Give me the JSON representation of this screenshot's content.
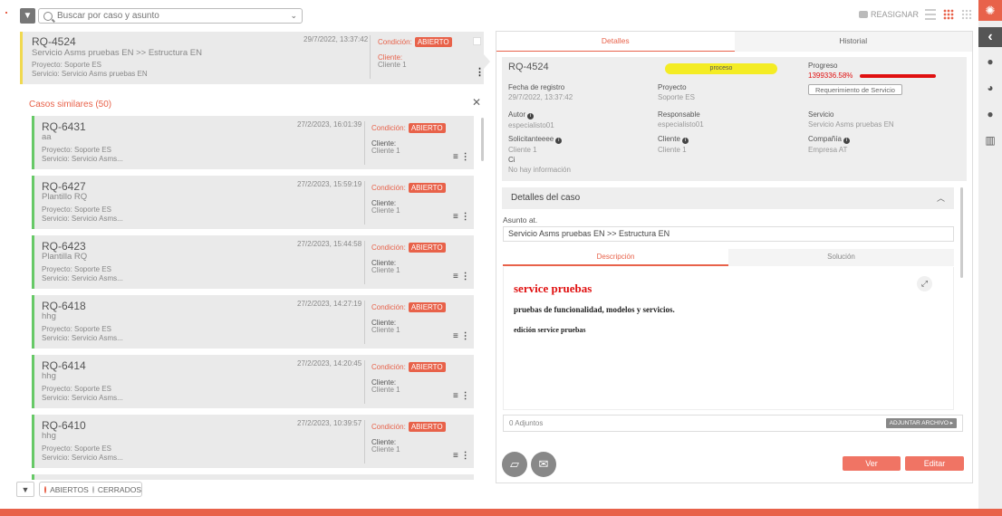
{
  "search": {
    "placeholder": "Buscar por caso y asunto"
  },
  "toolbar": {
    "reasignar": "REASIGNAR"
  },
  "selected": {
    "id": "RQ-4524",
    "subject": "Servicio Asms pruebas EN >> Estructura EN",
    "project": "Proyecto: Soporte ES",
    "service": "Servicio: Servicio Asms pruebas EN",
    "date": "29/7/2022, 13:37:42",
    "condition_label": "Condición:",
    "condition": "ABIERTO",
    "client_label": "Cliente:",
    "client": "Cliente 1"
  },
  "similar": {
    "title": "Casos similares (50)",
    "cases": [
      {
        "id": "RQ-6431",
        "subject": "aa",
        "project": "Proyecto: Soporte ES",
        "service": "Servicio: Servicio Asms...",
        "date": "27/2/2023, 16:01:39",
        "condition_label": "Condición:",
        "condition": "ABIERTO",
        "client_label": "Cliente:",
        "client": "Cliente 1"
      },
      {
        "id": "RQ-6427",
        "subject": "Plantillo RQ",
        "project": "Proyecto: Soporte ES",
        "service": "Servicio: Servicio Asms...",
        "date": "27/2/2023, 15:59:19",
        "condition_label": "Condición:",
        "condition": "ABIERTO",
        "client_label": "Cliente:",
        "client": "Cliente 1"
      },
      {
        "id": "RQ-6423",
        "subject": "Plantilla RQ",
        "project": "Proyecto: Soporte ES",
        "service": "Servicio: Servicio Asms...",
        "date": "27/2/2023, 15:44:58",
        "condition_label": "Condición:",
        "condition": "ABIERTO",
        "client_label": "Cliente:",
        "client": "Cliente 1"
      },
      {
        "id": "RQ-6418",
        "subject": "hhg",
        "project": "Proyecto: Soporte ES",
        "service": "Servicio: Servicio Asms...",
        "date": "27/2/2023, 14:27:19",
        "condition_label": "Condición:",
        "condition": "ABIERTO",
        "client_label": "Cliente:",
        "client": "Cliente 1"
      },
      {
        "id": "RQ-6414",
        "subject": "hhg",
        "project": "Proyecto: Soporte ES",
        "service": "Servicio: Servicio Asms...",
        "date": "27/2/2023, 14:20:45",
        "condition_label": "Condición:",
        "condition": "ABIERTO",
        "client_label": "Cliente:",
        "client": "Cliente 1"
      },
      {
        "id": "RQ-6410",
        "subject": "hhg",
        "project": "Proyecto: Soporte ES",
        "service": "Servicio: Servicio Asms...",
        "date": "27/2/2023, 10:39:57",
        "condition_label": "Condición:",
        "condition": "ABIERTO",
        "client_label": "Cliente:",
        "client": "Cliente 1"
      }
    ]
  },
  "filter": {
    "open_label": "ABIERTOS",
    "closed_label": "CERRADOS"
  },
  "detail": {
    "tabs": [
      "Detalles",
      "Historial"
    ],
    "case_id": "RQ-4524",
    "state": "proceso",
    "progress_label": "Progreso",
    "progress_value": "1399336.58%",
    "request_type": "Requerimiento de Servicio",
    "fields": {
      "fecha_label": "Fecha de registro",
      "fecha": "29/7/2022, 13:37:42",
      "proyecto_label": "Proyecto",
      "proyecto": "Soporte ES",
      "autor_label": "Autor",
      "autor": "especialisto01",
      "responsable_label": "Responsable",
      "responsable": "especialisto01",
      "servicio_label": "Servicio",
      "servicio": "Servicio Asms pruebas EN",
      "solicitante_label": "Solicitanteeee",
      "solicitante": "Cliente 1",
      "cliente_label": "Cliente",
      "cliente": "Cliente 1",
      "compania_label": "Compañía",
      "compania": "Empresa AT",
      "ci_label": "Ci",
      "ci": "No hay información"
    },
    "case_details_title": "Detalles del caso",
    "asunto_label": "Asunto at.",
    "asunto": "Servicio Asms pruebas EN >> Estructura EN",
    "subtabs": [
      "Descripción",
      "Solución"
    ],
    "desc_heading": "service pruebas",
    "desc_p1": "pruebas de funcionalidad, modelos y servicios.",
    "desc_p2": "edición service pruebas",
    "attachments": "0 Adjuntos",
    "attach_button": "ADJUNTAR ARCHIVO",
    "ver": "Ver",
    "editar": "Editar"
  }
}
